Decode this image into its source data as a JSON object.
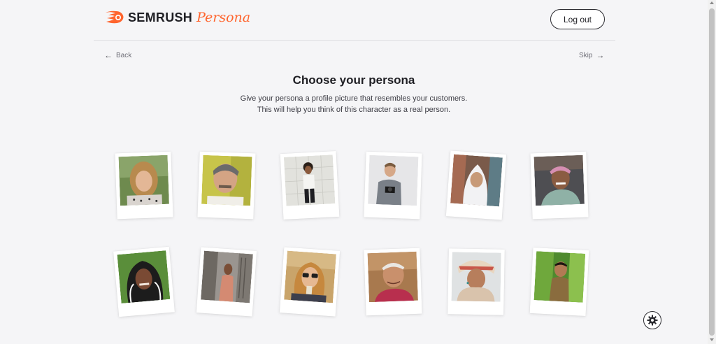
{
  "brand": {
    "name": "SEMRUSH",
    "product": "Persona",
    "accent": "#ff642d"
  },
  "header": {
    "logout_label": "Log out"
  },
  "nav": {
    "back_label": "Back",
    "skip_label": "Skip"
  },
  "main": {
    "title": "Choose your persona",
    "subtitle_line1": "Give your persona a profile picture that resembles your customers.",
    "subtitle_line2": "This will help you think of this character as a real person."
  },
  "personas": [
    "persona-photo-1",
    "persona-photo-2",
    "persona-photo-3",
    "persona-photo-4",
    "persona-photo-5",
    "persona-photo-6",
    "persona-photo-7",
    "persona-photo-8",
    "persona-photo-9",
    "persona-photo-10",
    "persona-photo-11",
    "persona-photo-12"
  ],
  "icons": {
    "back": "arrow-left-icon",
    "skip": "arrow-right-icon",
    "settings": "gear-icon"
  }
}
